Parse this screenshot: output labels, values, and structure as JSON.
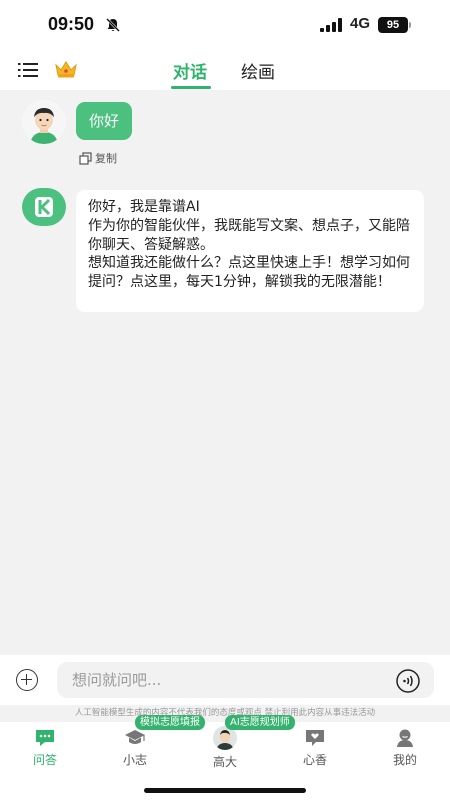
{
  "status_bar": {
    "time": "09:50",
    "network": "4G",
    "battery": "95",
    "icons": [
      "mute-icon",
      "signal-icon"
    ]
  },
  "header": {
    "tabs": [
      {
        "label": "对话",
        "active": true
      },
      {
        "label": "绘画",
        "active": false
      }
    ],
    "icons": [
      "menu-icon",
      "crown-icon"
    ]
  },
  "chat": {
    "messages": [
      {
        "role": "user",
        "text": "你好",
        "action_label": "复制"
      },
      {
        "role": "assistant",
        "lines": [
          "你好，我是靠谱AI",
          "作为你的智能伙伴，我既能写文案、想点子，又能陪你聊天、答疑解惑。",
          "想知道我还能做什么？点这里快速上手！想学习如何提问？点这里，每天1分钟，解锁我的无限潜能！"
        ]
      }
    ]
  },
  "input": {
    "placeholder": "想问就问吧...",
    "value": "",
    "disclaimer": "人工智能模型生成的内容不代表我们的态度或观点 禁止利用此内容从事违法活动"
  },
  "bottom_nav": {
    "items": [
      {
        "label": "问答",
        "icon": "chat-bubble-icon",
        "active": true
      },
      {
        "label": "小志",
        "icon": "graduation-cap-icon",
        "active": false
      },
      {
        "label": "高大",
        "icon": "avatar",
        "active": false
      },
      {
        "label": "心香",
        "icon": "heart-message-icon",
        "active": false
      },
      {
        "label": "我的",
        "icon": "person-icon",
        "active": false
      }
    ],
    "badges": [
      "模拟志愿填报",
      "AI志愿规划师"
    ]
  },
  "colors": {
    "accent": "#2fb36d",
    "user_bubble": "#4cc07f",
    "background": "#f2f2f2"
  }
}
